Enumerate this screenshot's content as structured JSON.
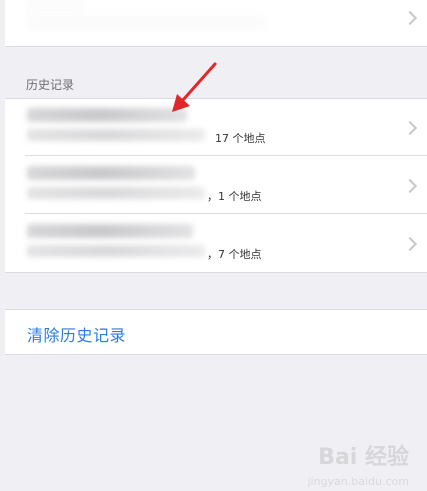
{
  "top_item": {
    "icon": "chevron-right-icon"
  },
  "history": {
    "header": "历史记录",
    "items": [
      {
        "count_text": "17 个地点"
      },
      {
        "count_text": "，1 个地点"
      },
      {
        "count_text": "，7 个地点"
      }
    ]
  },
  "clear_history": {
    "label": "清除历史记录"
  },
  "watermark": {
    "main": "Bai 经验",
    "sub": "jingyan.baidu.com"
  },
  "colors": {
    "background": "#efeff4",
    "accent": "#2d7be0",
    "annotation_arrow": "#e0282a"
  }
}
